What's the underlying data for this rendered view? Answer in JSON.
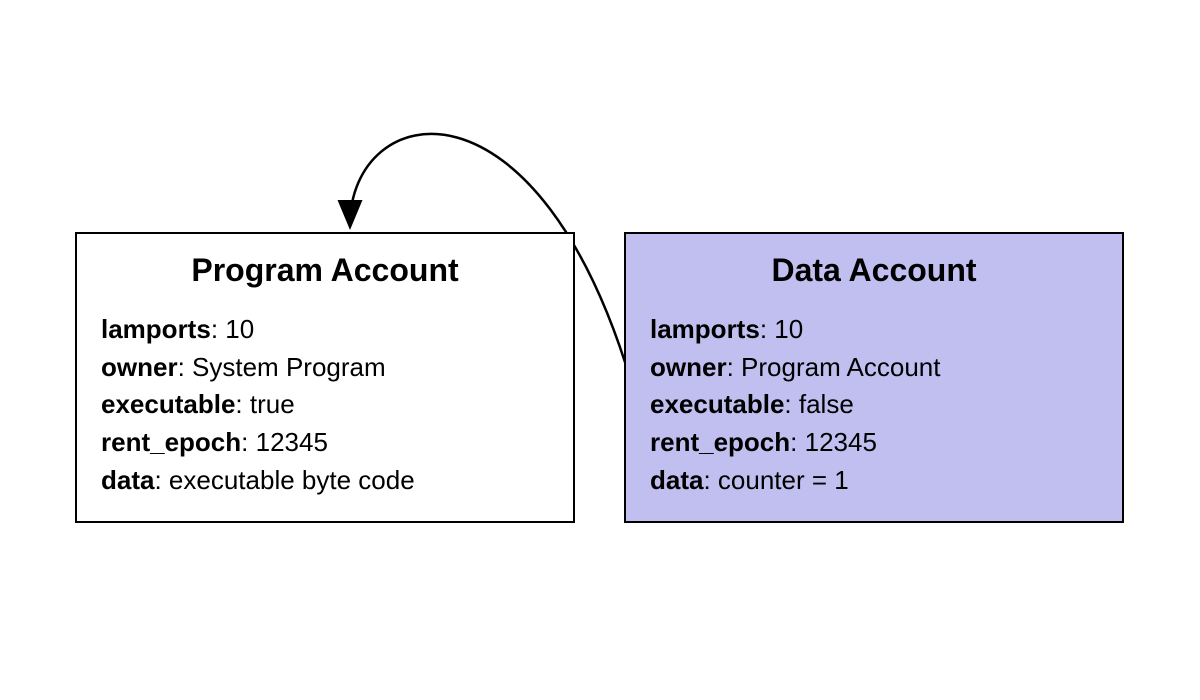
{
  "program_account": {
    "title": "Program Account",
    "fields": {
      "lamports_key": "lamports",
      "lamports_val": "10",
      "owner_key": "owner",
      "owner_val": "System Program",
      "executable_key": "executable",
      "executable_val": "true",
      "rent_epoch_key": "rent_epoch",
      "rent_epoch_val": "12345",
      "data_key": "data",
      "data_val": "executable byte code"
    }
  },
  "data_account": {
    "title": "Data Account",
    "fields": {
      "lamports_key": "lamports",
      "lamports_val": "10",
      "owner_key": "owner",
      "owner_val": "Program Account",
      "executable_key": "executable",
      "executable_val": "false",
      "rent_epoch_key": "rent_epoch",
      "rent_epoch_val": "12345",
      "data_key": "data",
      "data_val": "counter = 1"
    }
  },
  "relationship": {
    "description": "Data Account's owner points to Program Account"
  }
}
